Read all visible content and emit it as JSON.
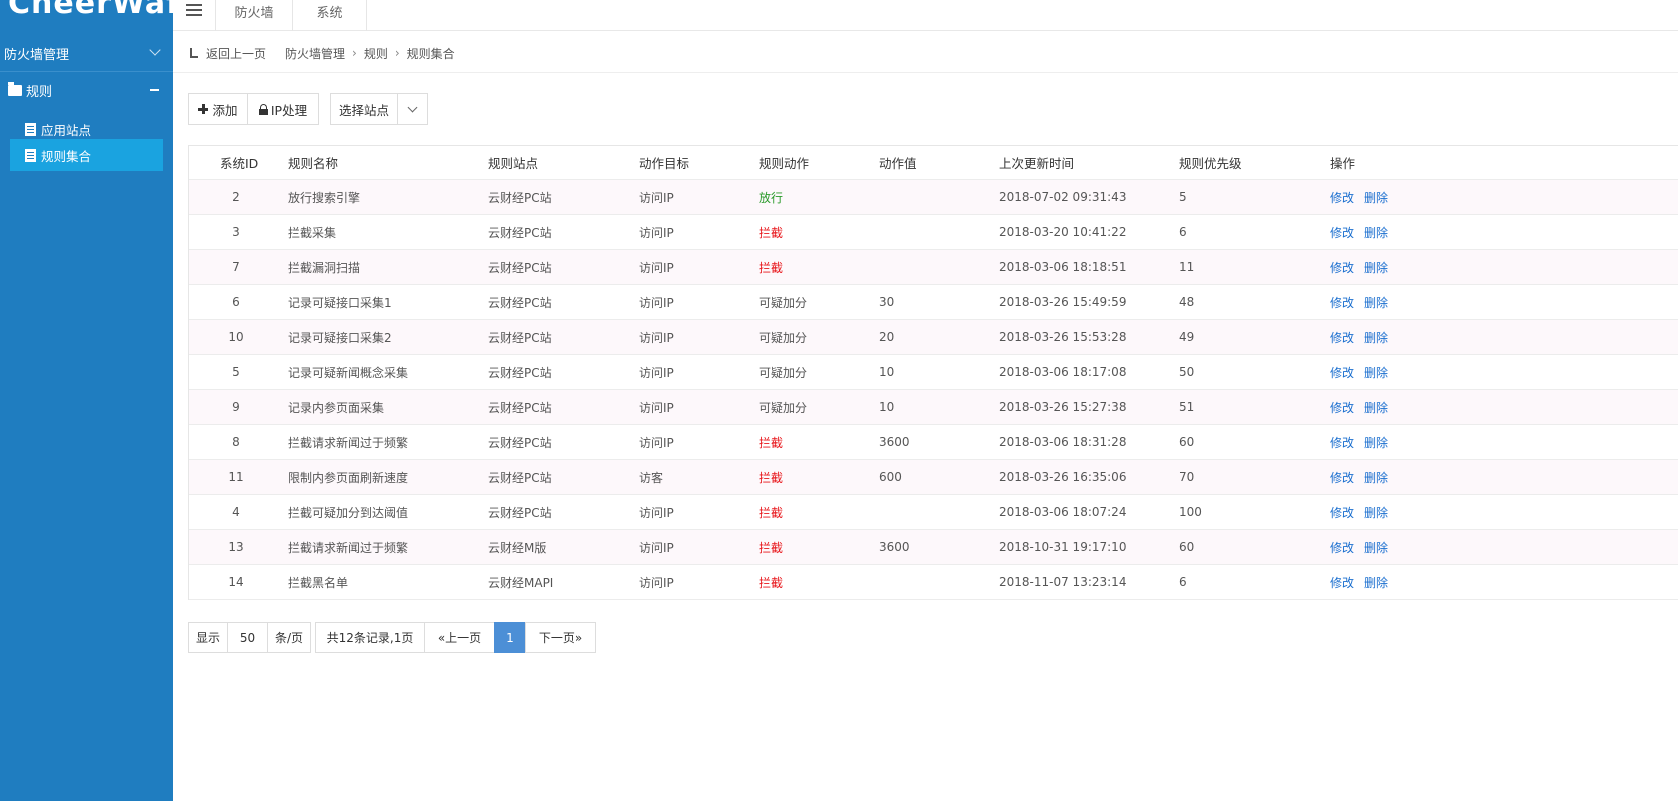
{
  "sidebar": {
    "logo": "CheerWaf",
    "menu_head": "防火墙管理",
    "group": "规则",
    "items": [
      {
        "label": "应用站点"
      },
      {
        "label": "规则集合"
      }
    ]
  },
  "topbar": {
    "tabs": [
      "防火墙",
      "系统"
    ]
  },
  "breadcrumb": {
    "back": "返回上一页",
    "path": [
      "防火墙管理",
      "规则",
      "规则集合"
    ]
  },
  "toolbar": {
    "add_label": "添加",
    "ip_label": "IP处理",
    "site_select_label": "选择站点"
  },
  "table": {
    "columns": [
      "系统ID",
      "规则名称",
      "规则站点",
      "动作目标",
      "规则动作",
      "动作值",
      "上次更新时间",
      "规则优先级",
      "操作"
    ],
    "rows": [
      {
        "id": "2",
        "name": "放行搜索引擎",
        "site": "云财经PC站",
        "target": "访问IP",
        "action": "放行",
        "value": "",
        "updated": "2018-07-02 09:31:43",
        "priority": "5"
      },
      {
        "id": "3",
        "name": "拦截采集",
        "site": "云财经PC站",
        "target": "访问IP",
        "action": "拦截",
        "value": "",
        "updated": "2018-03-20 10:41:22",
        "priority": "6"
      },
      {
        "id": "7",
        "name": "拦截漏洞扫描",
        "site": "云财经PC站",
        "target": "访问IP",
        "action": "拦截",
        "value": "",
        "updated": "2018-03-06 18:18:51",
        "priority": "11"
      },
      {
        "id": "6",
        "name": "记录可疑接口采集1",
        "site": "云财经PC站",
        "target": "访问IP",
        "action": "可疑加分",
        "value": "30",
        "updated": "2018-03-26 15:49:59",
        "priority": "48"
      },
      {
        "id": "10",
        "name": "记录可疑接口采集2",
        "site": "云财经PC站",
        "target": "访问IP",
        "action": "可疑加分",
        "value": "20",
        "updated": "2018-03-26 15:53:28",
        "priority": "49"
      },
      {
        "id": "5",
        "name": "记录可疑新闻概念采集",
        "site": "云财经PC站",
        "target": "访问IP",
        "action": "可疑加分",
        "value": "10",
        "updated": "2018-03-06 18:17:08",
        "priority": "50"
      },
      {
        "id": "9",
        "name": "记录内参页面采集",
        "site": "云财经PC站",
        "target": "访问IP",
        "action": "可疑加分",
        "value": "10",
        "updated": "2018-03-26 15:27:38",
        "priority": "51"
      },
      {
        "id": "8",
        "name": "拦截请求新闻过于频繁",
        "site": "云财经PC站",
        "target": "访问IP",
        "action": "拦截",
        "value": "3600",
        "updated": "2018-03-06 18:31:28",
        "priority": "60"
      },
      {
        "id": "11",
        "name": "限制内参页面刷新速度",
        "site": "云财经PC站",
        "target": "访客",
        "action": "拦截",
        "value": "600",
        "updated": "2018-03-26 16:35:06",
        "priority": "70"
      },
      {
        "id": "4",
        "name": "拦截可疑加分到达阈值",
        "site": "云财经PC站",
        "target": "访问IP",
        "action": "拦截",
        "value": "",
        "updated": "2018-03-06 18:07:24",
        "priority": "100"
      },
      {
        "id": "13",
        "name": "拦截请求新闻过于频繁",
        "site": "云财经M版",
        "target": "访问IP",
        "action": "拦截",
        "value": "3600",
        "updated": "2018-10-31 19:17:10",
        "priority": "60"
      },
      {
        "id": "14",
        "name": "拦截黑名单",
        "site": "云财经MAPI",
        "target": "访问IP",
        "action": "拦截",
        "value": "",
        "updated": "2018-11-07 13:23:14",
        "priority": "6"
      }
    ],
    "edit_label": "修改",
    "delete_label": "删除"
  },
  "pagination": {
    "show_label": "显示",
    "page_size": "50",
    "per_page_label": "条/页",
    "summary": "共12条记录,1页",
    "prev_label": "«上一页",
    "current_page": "1",
    "next_label": "下一页»"
  },
  "colors": {
    "sidebar_bg": "#1f7dc0",
    "sidebar_active": "#1aa3e0",
    "pass": "#2a9a2a",
    "block": "#e8161b",
    "link": "#1b6fcf",
    "page_active": "#4c8fd6"
  }
}
